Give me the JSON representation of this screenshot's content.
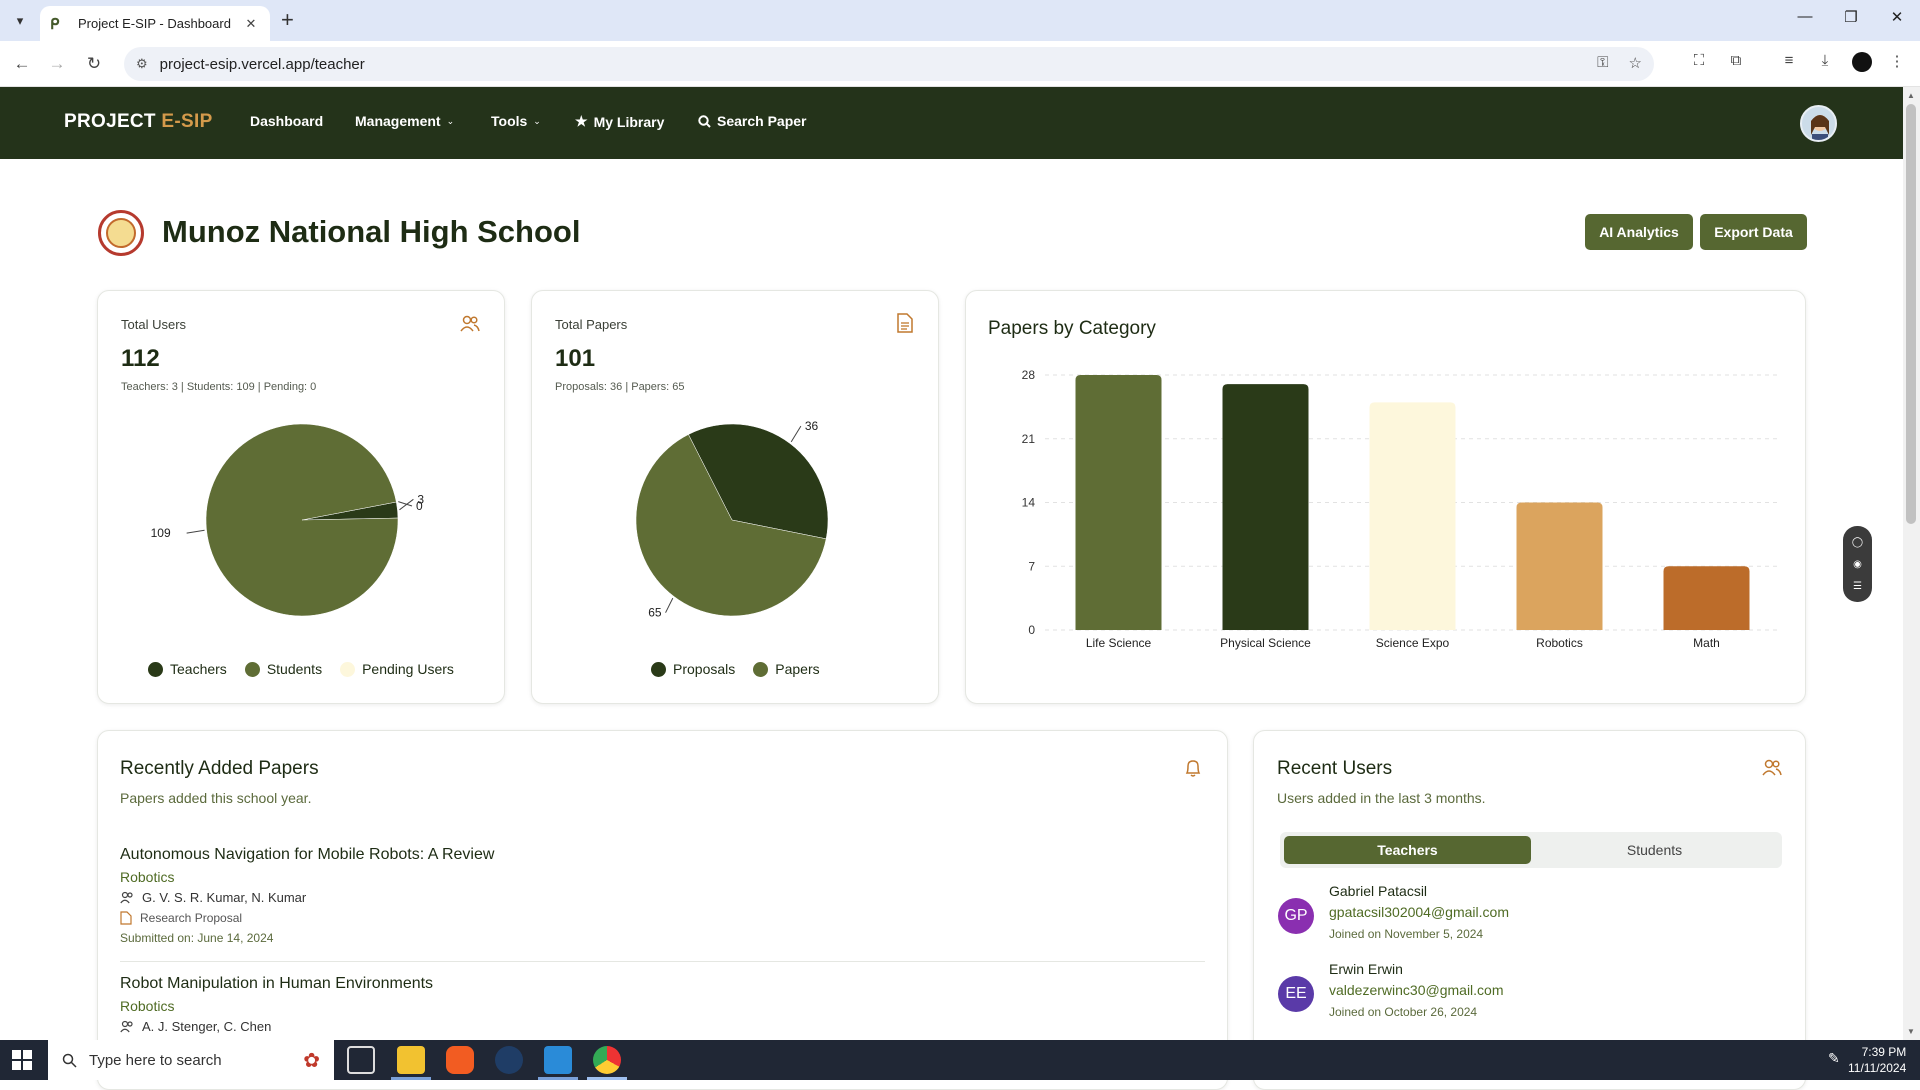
{
  "browser": {
    "tab_title": "Project E-SIP - Dashboard",
    "url": "project-esip.vercel.app/teacher"
  },
  "nav": {
    "brand_main": "PROJECT ",
    "brand_accent": "E-SIP",
    "links": [
      "Dashboard",
      "Management",
      "Tools",
      "My Library",
      "Search Paper"
    ]
  },
  "header": {
    "school_name": "Munoz National High School",
    "ai_button": "AI Analytics",
    "export_button": "Export Data"
  },
  "users_card": {
    "label": "Total Users",
    "value": "112",
    "sub": "Teachers: 3 | Students: 109 | Pending: 0",
    "pie_labels": [
      "109",
      "3",
      "0"
    ],
    "legend": [
      "Teachers",
      "Students",
      "Pending Users"
    ]
  },
  "papers_card": {
    "label": "Total Papers",
    "value": "101",
    "sub": "Proposals: 36 | Papers: 65",
    "pie_labels": [
      "36",
      "65"
    ],
    "legend": [
      "Proposals",
      "Papers"
    ]
  },
  "colors": {
    "dark_green": "#2a3a18",
    "olive": "#5f6d35",
    "cream": "#fdf7dc",
    "tan": "#dba45e",
    "rust": "#bc6c2a",
    "nav_bg": "#24331a",
    "button": "#566731"
  },
  "chart_data": [
    {
      "type": "pie",
      "labels": [
        "Teachers",
        "Students",
        "Pending Users"
      ],
      "values": [
        3,
        109,
        0
      ]
    },
    {
      "type": "pie",
      "labels": [
        "Proposals",
        "Papers"
      ],
      "values": [
        36,
        65
      ]
    },
    {
      "type": "bar",
      "title": "Papers by Category",
      "categories": [
        "Life Science",
        "Physical Science",
        "Science Expo",
        "Robotics",
        "Math"
      ],
      "values": [
        28,
        27,
        25,
        14,
        7
      ],
      "ylim": [
        0,
        28
      ],
      "yticks": [
        "0",
        "7",
        "14",
        "21",
        "28"
      ],
      "grid": true
    }
  ],
  "recent_papers": {
    "heading": "Recently Added Papers",
    "description": "Papers added this school year.",
    "items": [
      {
        "title": "Autonomous Navigation for Mobile Robots: A Review",
        "category": "Robotics",
        "authors": "G. V. S. R. Kumar, N. Kumar",
        "type": "Research Proposal",
        "date": "Submitted on: June 14, 2024"
      },
      {
        "title": "Robot Manipulation in Human Environments",
        "category": "Robotics",
        "authors": "A. J. Stenger, C. Chen"
      }
    ]
  },
  "recent_users": {
    "heading": "Recent Users",
    "description": "Users added in the last 3 months.",
    "tabs": [
      "Teachers",
      "Students"
    ],
    "items": [
      {
        "initials": "GP",
        "name": "Gabriel Patacsil",
        "email": "gpatacsil302004@gmail.com",
        "joined": "Joined on November 5, 2024"
      },
      {
        "initials": "EE",
        "name": "Erwin Erwin",
        "email": "valdezerwinc30@gmail.com",
        "joined": "Joined on October 26, 2024"
      }
    ]
  },
  "taskbar": {
    "search_placeholder": "Type here to search",
    "time": "7:39 PM",
    "date": "11/11/2024"
  }
}
